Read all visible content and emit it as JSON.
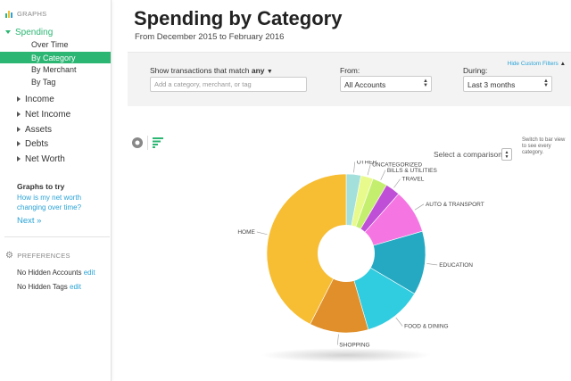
{
  "sidebar": {
    "graphs_heading": "GRAPHS",
    "spending": "Spending",
    "spending_items": [
      "Over Time",
      "By Category",
      "By Merchant",
      "By Tag"
    ],
    "top_items": [
      "Income",
      "Net Income",
      "Assets",
      "Debts",
      "Net Worth"
    ],
    "graphs_to_try": "Graphs to try",
    "try_link": "How is my net worth changing over time?",
    "next": "Next »",
    "preferences_heading": "PREFERENCES",
    "hidden_accounts": "No Hidden Accounts",
    "hidden_tags": "No Hidden Tags",
    "edit": "edit"
  },
  "header": {
    "title": "Spending by Category",
    "subtitle": "From December 2015 to February 2016"
  },
  "filters": {
    "hide_link": "Hide Custom Filters",
    "match_label": "Show transactions that match",
    "match_value": "any",
    "search_placeholder": "Add a category, merchant, or tag",
    "from_label": "From:",
    "from_value": "All Accounts",
    "during_label": "During:",
    "during_value": "Last 3 months"
  },
  "controls": {
    "comparison": "Select a comparison",
    "hint": "Switch to bar view to see every category."
  },
  "chart_data": {
    "type": "pie",
    "categories": [
      "OTHER",
      "UNCATEGORIZED",
      "BILLS & UTILITIES",
      "TRAVEL",
      "AUTO & TRANSPORT",
      "EDUCATION",
      "FOOD & DINING",
      "SHOPPING",
      "HOME"
    ],
    "values": [
      3,
      2.5,
      3,
      3,
      9,
      13,
      12,
      12,
      42.5
    ],
    "colors": [
      "#a3e0dc",
      "#e9fa8c",
      "#c4ef6e",
      "#bf4fd6",
      "#f576e2",
      "#25a9c3",
      "#30ccdf",
      "#e08f2a",
      "#f7bd33"
    ],
    "donut": true
  }
}
